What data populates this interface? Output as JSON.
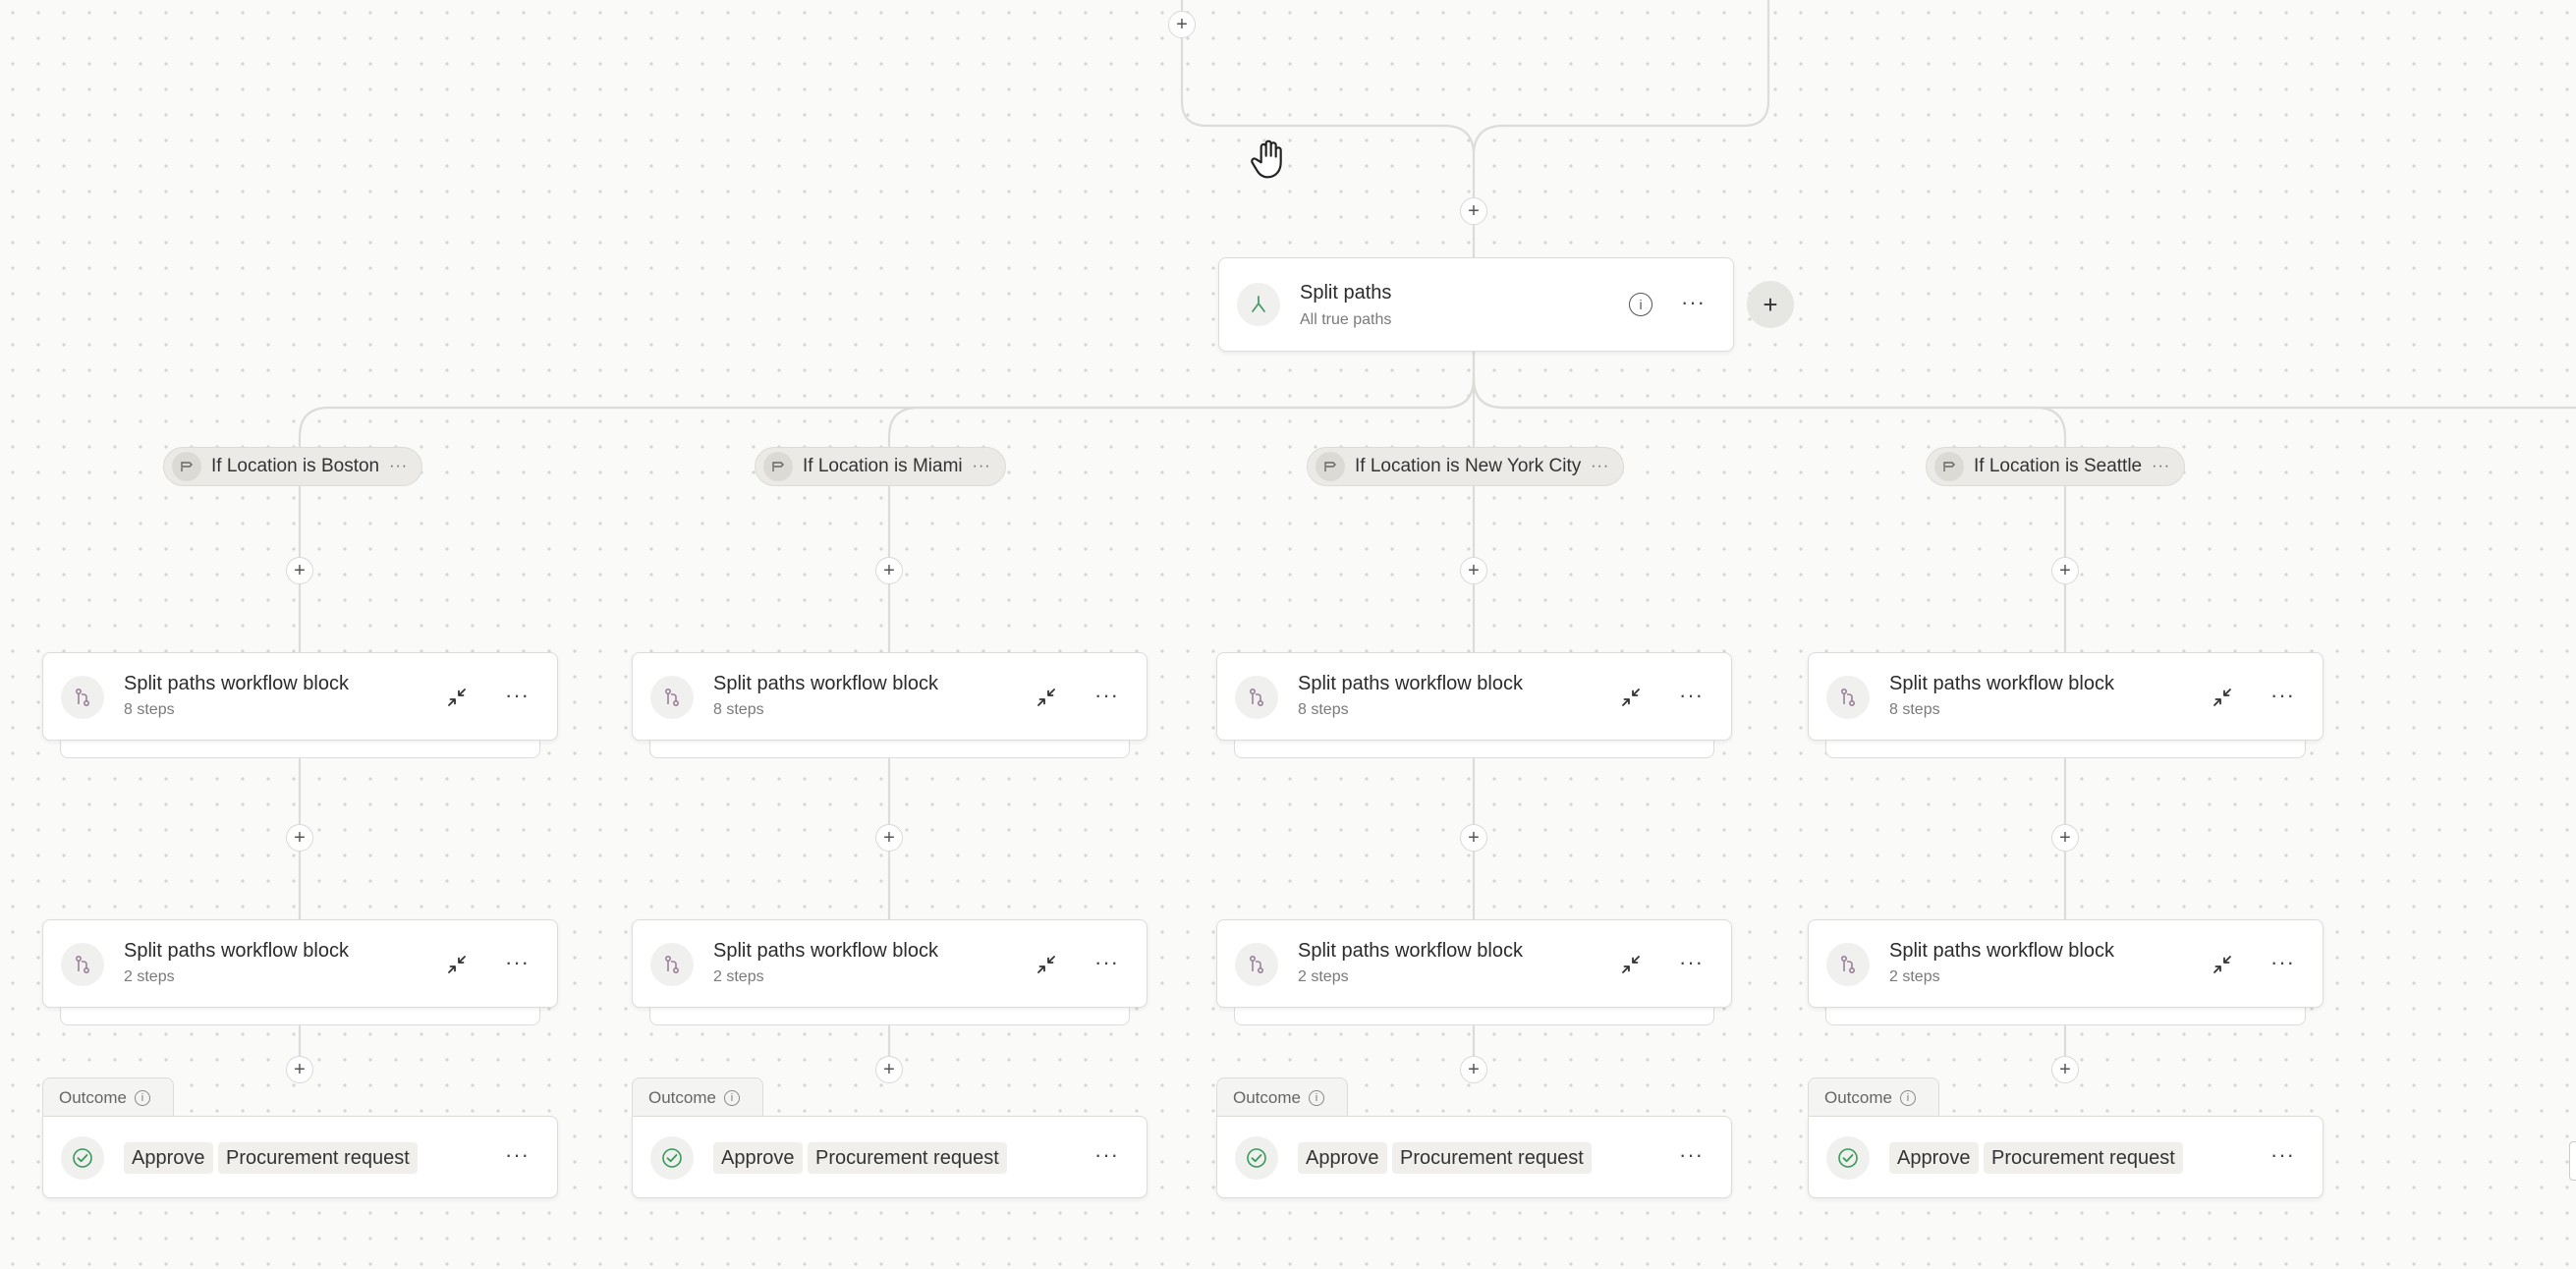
{
  "split_node": {
    "title": "Split paths",
    "subtitle": "All true paths",
    "info_icon": "info-icon",
    "menu_icon": "more-horizontal-icon",
    "add_icon": "plus-icon",
    "add_label": "+"
  },
  "plus_label": "+",
  "more_label": "···",
  "paths": [
    {
      "condition": "If Location is Boston",
      "blocks": [
        {
          "title": "Split paths workflow block",
          "steps": "8 steps"
        },
        {
          "title": "Split paths workflow block",
          "steps": "2 steps"
        }
      ],
      "outcome": {
        "label": "Outcome",
        "action": "Approve",
        "item": "Procurement request"
      }
    },
    {
      "condition": "If Location is Miami",
      "blocks": [
        {
          "title": "Split paths workflow block",
          "steps": "8 steps"
        },
        {
          "title": "Split paths workflow block",
          "steps": "2 steps"
        }
      ],
      "outcome": {
        "label": "Outcome",
        "action": "Approve",
        "item": "Procurement request"
      }
    },
    {
      "condition": "If Location is New York City",
      "blocks": [
        {
          "title": "Split paths workflow block",
          "steps": "8 steps"
        },
        {
          "title": "Split paths workflow block",
          "steps": "2 steps"
        }
      ],
      "outcome": {
        "label": "Outcome",
        "action": "Approve",
        "item": "Procurement request"
      }
    },
    {
      "condition": "If Location is Seattle",
      "blocks": [
        {
          "title": "Split paths workflow block",
          "steps": "8 steps"
        },
        {
          "title": "Split paths workflow block",
          "steps": "2 steps"
        }
      ],
      "outcome": {
        "label": "Outcome",
        "action": "Approve",
        "item": "Procurement request"
      }
    }
  ],
  "colors": {
    "canvas": "#fafaf9",
    "connector": "#dcdcd8",
    "block_icon": "#9b7f9b",
    "outcome_check": "#3a9a5b"
  },
  "icons": {
    "cursor": "hand-grab-icon",
    "split": "split-icon",
    "condition": "condition-icon",
    "block": "workflow-block-icon",
    "collapse": "collapse-icon",
    "check": "check-circle-icon"
  }
}
